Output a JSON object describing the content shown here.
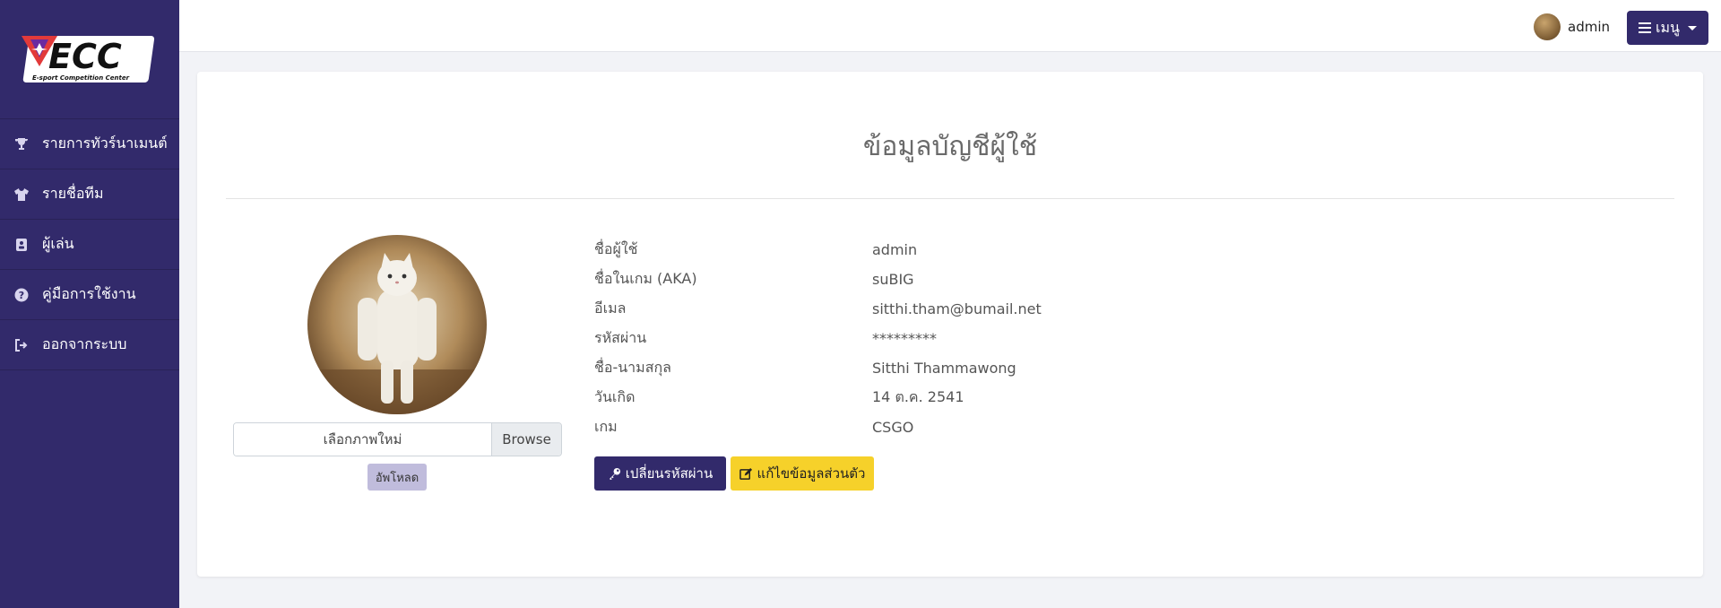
{
  "logo": {
    "mark": "ECC",
    "caption": "E-sport Competition Center"
  },
  "sidebar": {
    "items": [
      {
        "label": "รายการทัวร์นาเมนต์",
        "icon": "trophy-icon"
      },
      {
        "label": "รายชื่อทีม",
        "icon": "tshirt-icon"
      },
      {
        "label": "ผู้เล่น",
        "icon": "id-badge-icon"
      },
      {
        "label": "คู่มือการใช้งาน",
        "icon": "question-circle-icon"
      },
      {
        "label": "ออกจากระบบ",
        "icon": "sign-out-icon"
      }
    ]
  },
  "topbar": {
    "username": "admin",
    "menu_label": "เมนู"
  },
  "page": {
    "title": "ข้อมูลบัญชีผู้ใช้"
  },
  "upload": {
    "file_placeholder": "เลือกภาพใหม่",
    "browse_label": "Browse",
    "upload_label": "อัพโหลด"
  },
  "profile": {
    "fields": [
      {
        "label": "ชื่อผู้ใช้",
        "value": "admin"
      },
      {
        "label": "ชื่อในเกม (AKA)",
        "value": "suBIG"
      },
      {
        "label": "อีเมล",
        "value": "sitthi.tham@bumail.net"
      },
      {
        "label": "รหัสผ่าน",
        "value": "*********"
      },
      {
        "label": "ชื่อ-นามสกุล",
        "value": "Sitthi Thammawong"
      },
      {
        "label": "วันเกิด",
        "value": "14 ต.ค. 2541"
      },
      {
        "label": "เกม",
        "value": "CSGO"
      }
    ]
  },
  "actions": {
    "change_password": "เปลี่ยนรหัสผ่าน",
    "edit_profile": "แก้ไขข้อมูลส่วนตัว"
  },
  "colors": {
    "brand": "#322a6b",
    "accent_yellow": "#f6d12a",
    "logo_red": "#e23a3a"
  }
}
